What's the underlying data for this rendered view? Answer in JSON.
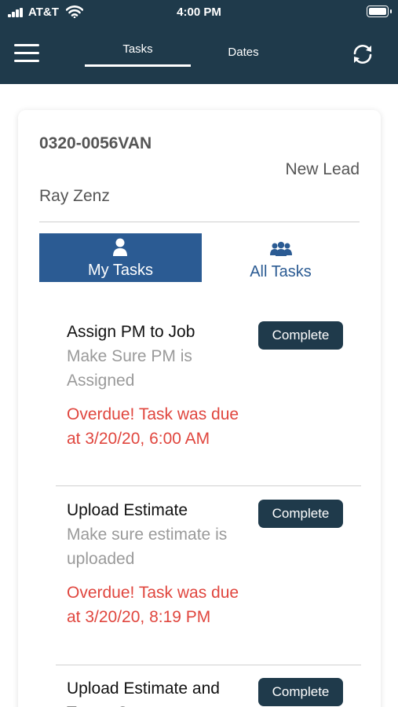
{
  "status_bar": {
    "carrier": "AT&T",
    "time": "4:00 PM"
  },
  "nav": {
    "tabs": [
      {
        "label": "Tasks",
        "active": true
      },
      {
        "label": "Dates",
        "active": false
      }
    ],
    "icons": {
      "menu": "hamburger-menu-icon",
      "refresh": "refresh-icon"
    }
  },
  "job": {
    "id": "0320-0056VAN",
    "status": "New Lead",
    "customer": "Ray Zenz"
  },
  "task_filter": {
    "my_tasks_label": "My Tasks",
    "all_tasks_label": "All Tasks",
    "selected": "My Tasks"
  },
  "tasks": [
    {
      "title": "Assign PM to Job",
      "description": "Make Sure PM is Assigned",
      "overdue": "Overdue! Task was due at 3/20/20, 6:00 AM",
      "button": "Complete"
    },
    {
      "title": "Upload Estimate",
      "description": "Make sure estimate is uploaded",
      "overdue": "Overdue! Task was due at 3/20/20, 8:19 PM",
      "button": "Complete"
    },
    {
      "title": "Upload Estimate and Target Start",
      "description": "",
      "overdue": "",
      "button": "Complete"
    }
  ],
  "colors": {
    "header_bg": "#1f3a4b",
    "accent_blue": "#2b5b93",
    "overdue_red": "#e0463e",
    "button_bg": "#1f3a4b"
  }
}
